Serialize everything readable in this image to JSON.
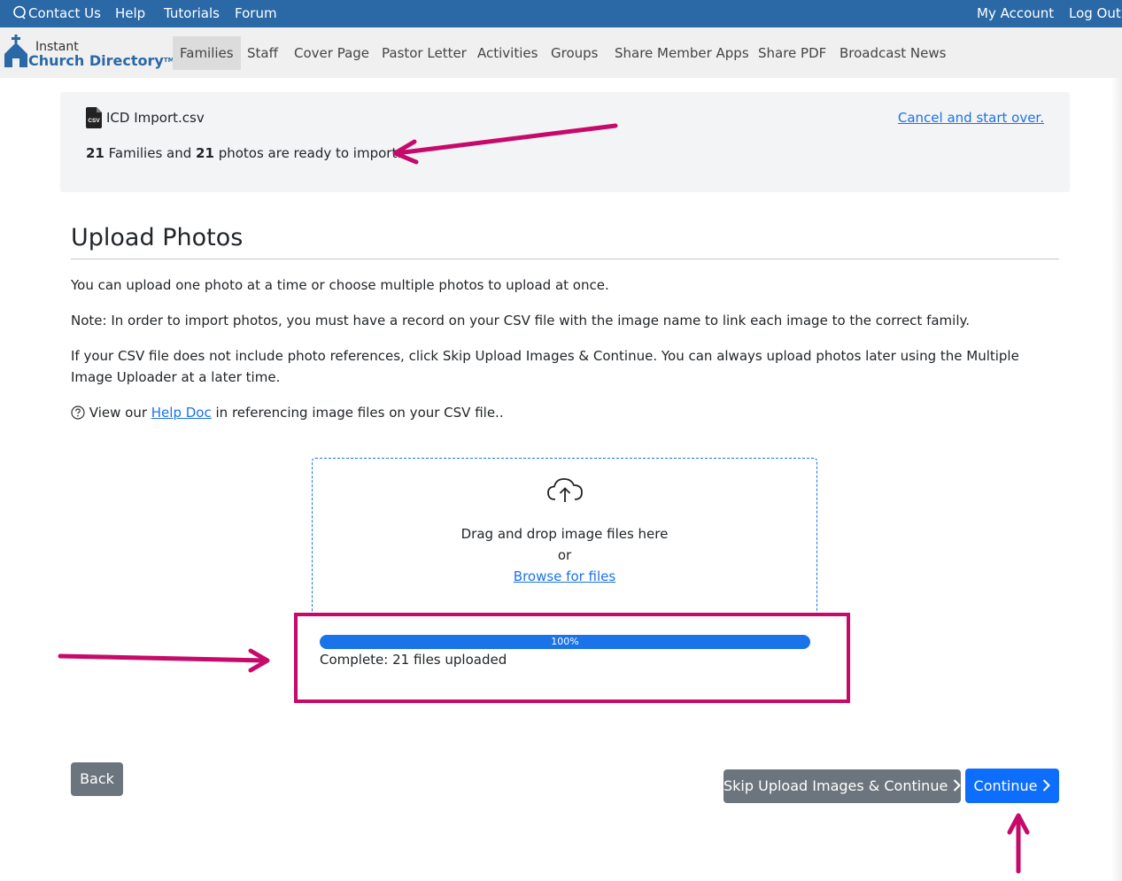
{
  "topbar": {
    "contact": "Contact Us",
    "help": "Help",
    "tutorials": "Tutorials",
    "forum": "Forum",
    "account": "My Account",
    "logout": "Log Out"
  },
  "logo": {
    "line1": "Instant",
    "line2": "Church Directory",
    "tm": "TM"
  },
  "nav": {
    "families": "Families",
    "staff": "Staff",
    "cover": "Cover Page",
    "pastor": "Pastor Letter",
    "activities": "Activities",
    "groups": "Groups",
    "share_apps": "Share Member Apps",
    "share_pdf": "Share PDF",
    "broadcast": "Broadcast News"
  },
  "import": {
    "file_icon_label": "CSV",
    "filename": "ICD Import.csv",
    "cancel": "Cancel and start over.",
    "families_count": "21",
    "families_word": "Families and",
    "photos_count": "21",
    "photos_word": "photos are ready to import."
  },
  "page": {
    "title": "Upload Photos",
    "p1": "You can upload one photo at a time or choose multiple photos to upload at once.",
    "p2": "Note: In order to import photos, you must have a record on your CSV file with the image name to link each image to the correct family.",
    "p3": "If your CSV file does not include photo references, click Skip Upload Images & Continue. You can always upload photos later using the Multiple Image Uploader at a later time.",
    "help_prefix": "View our",
    "help_link": "Help Doc",
    "help_suffix": "in referencing image files on your CSV file.."
  },
  "dropzone": {
    "drag_text": "Drag and drop image files here",
    "or": "or",
    "browse": "Browse for files"
  },
  "progress": {
    "percent": 100,
    "label": "100%",
    "status": "Complete: 21 files uploaded"
  },
  "buttons": {
    "back": "Back",
    "skip": "Skip Upload Images & Continue",
    "continue": "Continue"
  },
  "colors": {
    "topbar": "#2a68a6",
    "accent": "#1a73e8",
    "primary": "#0d6efd",
    "secondary": "#6c757d",
    "annotation": "#c70a6a"
  }
}
